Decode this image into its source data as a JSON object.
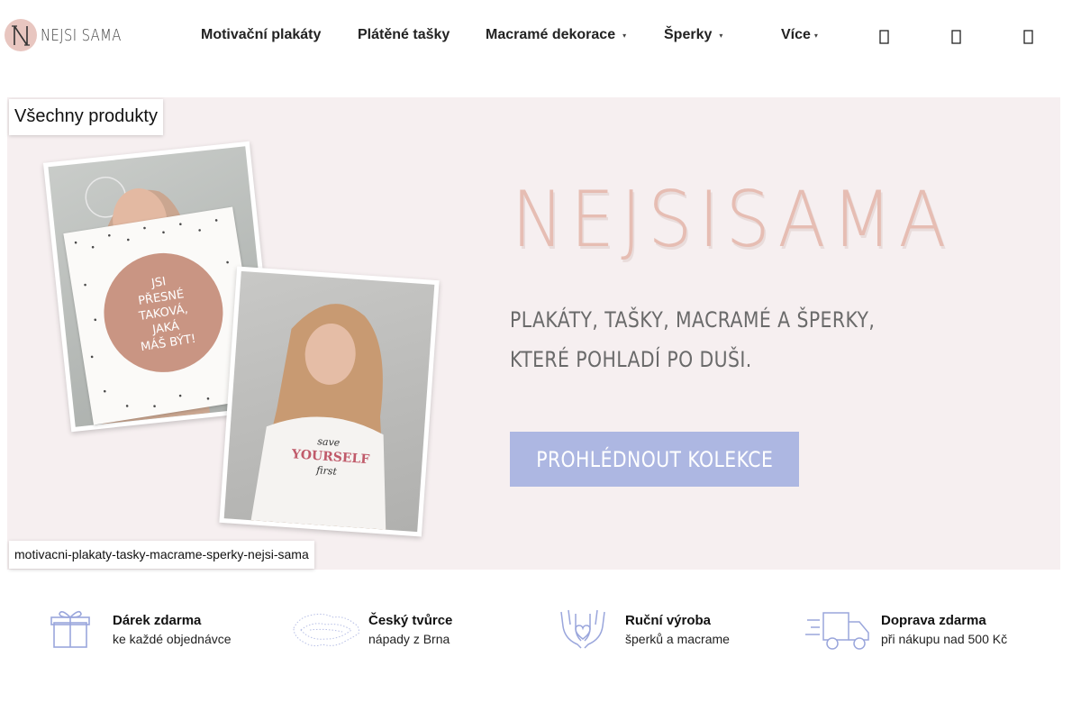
{
  "logo": {
    "text": "NEJSI SAMA"
  },
  "nav": {
    "items": [
      {
        "label": "Motivační plakáty"
      },
      {
        "label": "Plátěné tašky"
      },
      {
        "label": "Macramé dekorace",
        "caret": "▾"
      },
      {
        "label": "Šperky",
        "caret": "▾"
      },
      {
        "label": "Více",
        "caret": "▾"
      }
    ],
    "icons": [
      "search-icon",
      "user-icon",
      "cart-icon"
    ]
  },
  "hero": {
    "category_tag": "Všechny produkty",
    "image_alt": "motivacni-plakaty-tasky-macrame-sperky-nejsi-sama",
    "brand_title": "NEJSISAMA",
    "subtitle_line1": "PLAKÁTY, TAŠKY, MACRAMÉ A ŠPERKY,",
    "subtitle_line2": "KTERÉ POHLADÍ PO DUŠI.",
    "cta": "PROHLÉDNOUT KOLEKCE",
    "poster_text": [
      "JSI",
      "PŘESNÉ",
      "TAKOVÁ,",
      "JAKÁ",
      "MÁŠ BÝT!"
    ],
    "shirt_text": [
      "save",
      "YOURSELF",
      "first"
    ],
    "colors": {
      "background": "#f6eff0",
      "title": "#e6bdb3",
      "cta": "#adb7e2"
    }
  },
  "features": [
    {
      "icon": "gift-icon",
      "title": "Dárek zdarma",
      "subtitle": "ke každé objednávce"
    },
    {
      "icon": "czech-map-icon",
      "title": "Český tvůrce",
      "subtitle": "nápady z Brna"
    },
    {
      "icon": "hands-heart-icon",
      "title": "Ruční výroba",
      "subtitle": "šperků a macrame"
    },
    {
      "icon": "delivery-truck-icon",
      "title": "Doprava zdarma",
      "subtitle": "při nákupu nad 500 Kč"
    }
  ]
}
